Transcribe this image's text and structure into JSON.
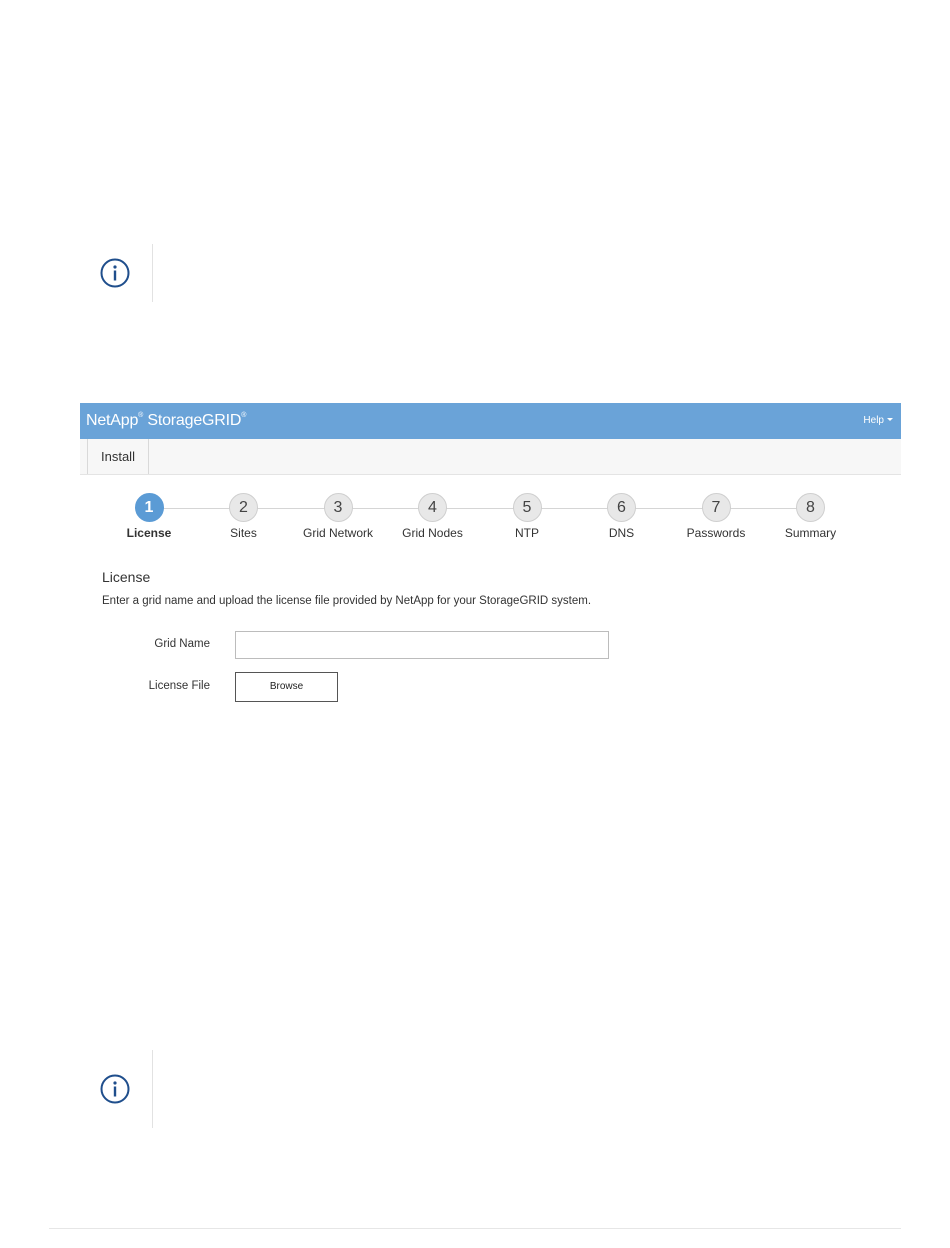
{
  "app": {
    "brand": "NetApp",
    "brand_mark": "®",
    "product": "StorageGRID",
    "product_mark": "®",
    "help_label": "Help",
    "nav_tab": "Install"
  },
  "stepper": {
    "steps": [
      {
        "number": "1",
        "label": "License",
        "active": true
      },
      {
        "number": "2",
        "label": "Sites",
        "active": false
      },
      {
        "number": "3",
        "label": "Grid Network",
        "active": false
      },
      {
        "number": "4",
        "label": "Grid Nodes",
        "active": false
      },
      {
        "number": "5",
        "label": "NTP",
        "active": false
      },
      {
        "number": "6",
        "label": "DNS",
        "active": false
      },
      {
        "number": "7",
        "label": "Passwords",
        "active": false
      },
      {
        "number": "8",
        "label": "Summary",
        "active": false
      }
    ]
  },
  "license": {
    "title": "License",
    "description": "Enter a grid name and upload the license file provided by NetApp for your StorageGRID system.",
    "grid_name_label": "Grid Name",
    "grid_name_value": "",
    "license_file_label": "License File",
    "browse_label": "Browse"
  },
  "icons": {
    "note_icon": "info-circle-icon"
  },
  "colors": {
    "header": "#6aa3d8",
    "active_step": "#5b9bd5",
    "icon": "#1f4e8c"
  }
}
